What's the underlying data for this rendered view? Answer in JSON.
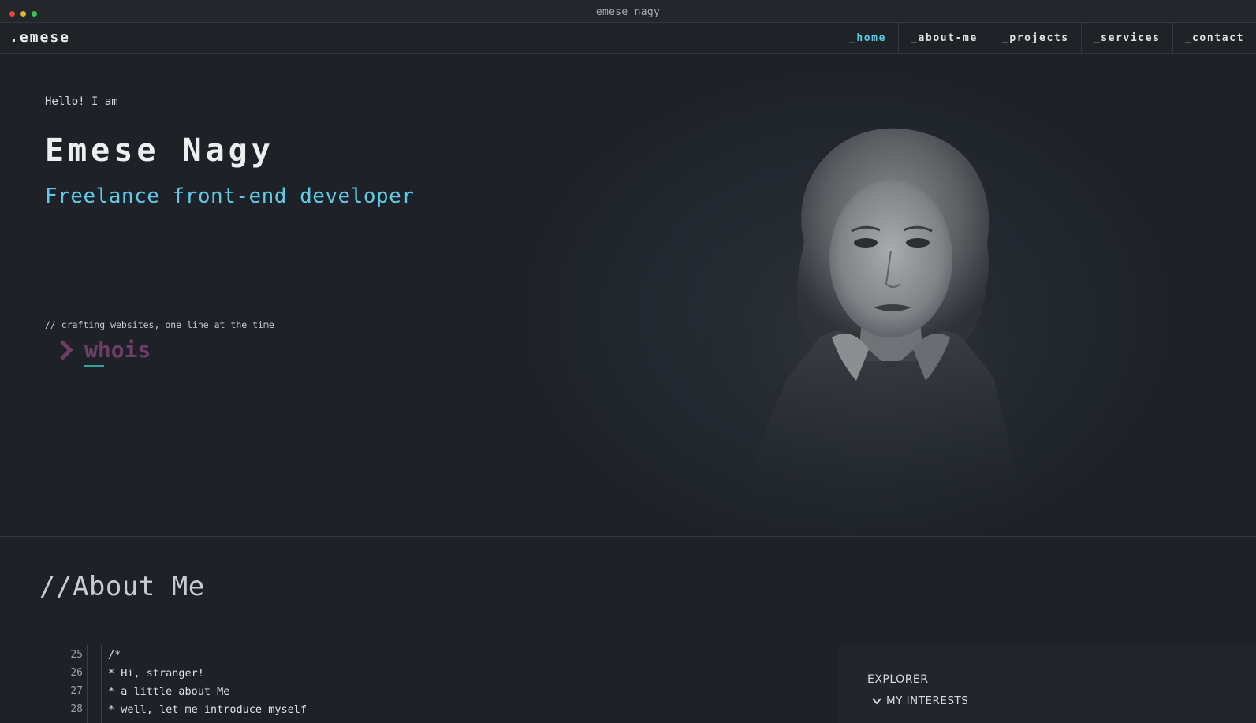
{
  "window": {
    "title": "emese_nagy"
  },
  "nav": {
    "logo": ".emese",
    "links": [
      "_home",
      "_about-me",
      "_projects",
      "_services",
      "_contact"
    ]
  },
  "hero": {
    "greeting": "Hello! I am",
    "name": "Emese Nagy",
    "role": "Freelance front-end developer",
    "comment": "// crafting websites, one line at the time",
    "command": "whois"
  },
  "about": {
    "title": "//About Me",
    "code_lines": [
      {
        "num": "25",
        "text": "/*"
      },
      {
        "num": "26",
        "text": "* Hi, stranger!"
      },
      {
        "num": "27",
        "text": "* a little about Me"
      },
      {
        "num": "28",
        "text": "* well, let me introduce myself"
      }
    ]
  },
  "explorer": {
    "title": "EXPLORER",
    "folder": "MY INTERESTS"
  },
  "colors": {
    "background": "#1e2228",
    "accent": "#5fc9e6",
    "command": "#6e3f66",
    "cursor": "#37a3a0"
  }
}
